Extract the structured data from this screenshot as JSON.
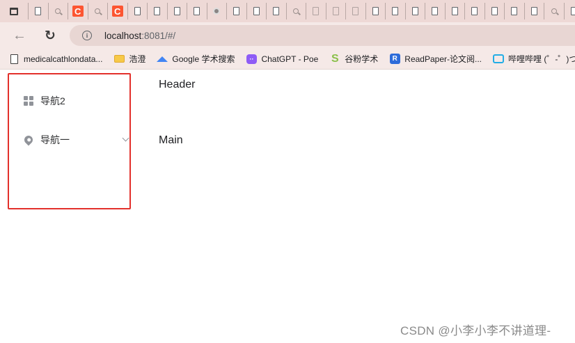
{
  "browser": {
    "tabs": [
      {
        "icon": "document-icon"
      },
      {
        "icon": "search-icon"
      },
      {
        "icon": "csdn-icon"
      },
      {
        "icon": "search-icon"
      },
      {
        "icon": "csdn-icon"
      },
      {
        "icon": "document-icon"
      },
      {
        "icon": "document-icon"
      },
      {
        "icon": "document-icon"
      },
      {
        "icon": "document-icon"
      },
      {
        "icon": "blocked-icon"
      },
      {
        "icon": "document-icon"
      },
      {
        "icon": "document-icon"
      },
      {
        "icon": "document-icon"
      },
      {
        "icon": "search-icon"
      },
      {
        "icon": "document-gray-icon"
      },
      {
        "icon": "document-gray-icon"
      },
      {
        "icon": "document-gray-icon"
      },
      {
        "icon": "document-icon"
      },
      {
        "icon": "document-icon"
      },
      {
        "icon": "document-icon"
      },
      {
        "icon": "document-icon"
      },
      {
        "icon": "document-icon"
      },
      {
        "icon": "document-icon"
      },
      {
        "icon": "document-icon"
      },
      {
        "icon": "document-icon"
      },
      {
        "icon": "document-icon"
      },
      {
        "icon": "search-icon"
      },
      {
        "icon": "document-icon"
      }
    ],
    "url_host": "localhost",
    "url_rest": ":8081/#/",
    "csdn_glyph": "C",
    "info_glyph": "i",
    "back_glyph": "←",
    "reload_glyph": "↻"
  },
  "bookmarks": [
    {
      "label": "medicalcathlondata...",
      "icon": "document-icon"
    },
    {
      "label": "浩澄",
      "icon": "folder-icon"
    },
    {
      "label": "Google 学术搜索",
      "icon": "scholar-icon"
    },
    {
      "label": "ChatGPT - Poe",
      "icon": "poe-icon"
    },
    {
      "label": "谷粉学术",
      "icon": "gufen-icon"
    },
    {
      "label": "ReadPaper-论文阅...",
      "icon": "readpaper-icon"
    },
    {
      "label": "哔哩哔哩 (゜-゜)つ",
      "icon": "bilibili-icon"
    }
  ],
  "bookmark_glyphs": {
    "poe": "··",
    "gufen": "S",
    "readpaper": "R"
  },
  "sidebar": {
    "items": [
      {
        "label": "导航2",
        "icon": "grid-icon"
      },
      {
        "label": "导航一",
        "icon": "location-icon",
        "expandable": true
      }
    ]
  },
  "main": {
    "header": "Header",
    "main": "Main"
  },
  "watermark": "CSDN @小李小李不讲道理-",
  "colors": {
    "tabstrip": "#eed9d6",
    "toolbar": "#f5e9e7",
    "highlight_border": "#e3302b",
    "icon_gray": "#909399"
  }
}
